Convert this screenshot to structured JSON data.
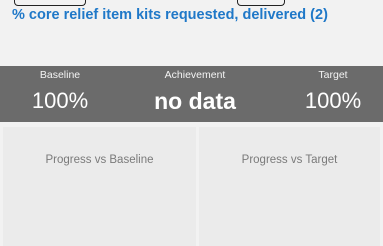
{
  "title": "% core relief item kits requested, delivered (2)",
  "kpis": {
    "baseline": {
      "label": "Baseline",
      "value": "100%"
    },
    "achievement": {
      "label": "Achievement",
      "value": "no data"
    },
    "target": {
      "label": "Target",
      "value": "100%"
    }
  },
  "panels": {
    "progress_vs_baseline": "Progress vs Baseline",
    "progress_vs_target": "Progress vs Target"
  },
  "colors": {
    "title": "#1f78c8",
    "kpi_band": "#6b6b6b",
    "background": "#f2f2f2",
    "panel": "#ebebeb"
  }
}
